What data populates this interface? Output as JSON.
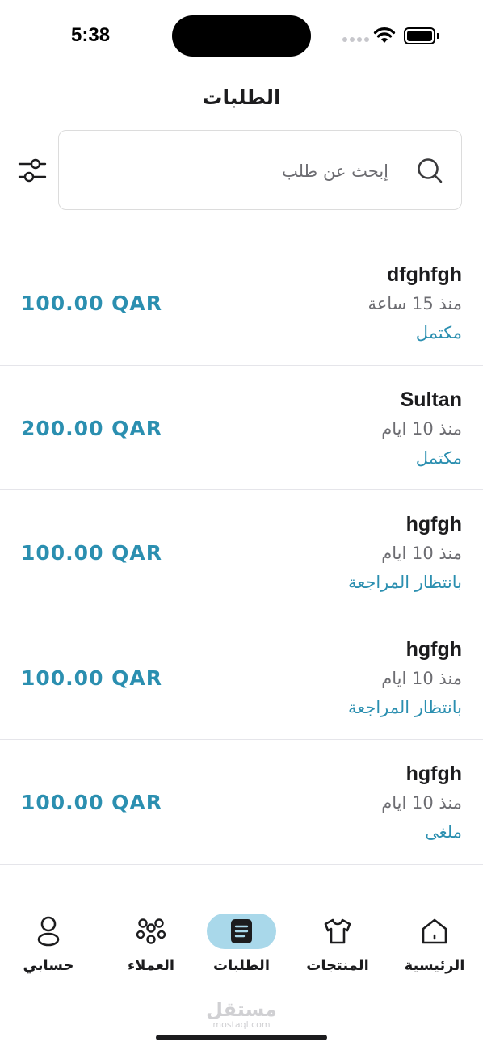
{
  "status_bar": {
    "time": "5:38"
  },
  "header": {
    "title": "الطلبات"
  },
  "search": {
    "placeholder": "إبحث عن طلب"
  },
  "orders": [
    {
      "name": "dfghfgh",
      "time": "منذ 15 ساعة",
      "status": "مكتمل",
      "price": "100.00 QAR"
    },
    {
      "name": "Sultan",
      "time": "منذ 10 ايام",
      "status": "مكتمل",
      "price": "200.00 QAR"
    },
    {
      "name": "hgfgh",
      "time": "منذ 10 ايام",
      "status": "بانتظار المراجعة",
      "price": "100.00 QAR"
    },
    {
      "name": "hgfgh",
      "time": "منذ 10 ايام",
      "status": "بانتظار المراجعة",
      "price": "100.00 QAR"
    },
    {
      "name": "hgfgh",
      "time": "منذ 10 ايام",
      "status": "ملغى",
      "price": "100.00 QAR"
    }
  ],
  "tabs": [
    {
      "label": "الرئيسية",
      "icon": "home-icon"
    },
    {
      "label": "المنتجات",
      "icon": "shirt-icon"
    },
    {
      "label": "الطلبات",
      "icon": "orders-icon",
      "active": true
    },
    {
      "label": "العملاء",
      "icon": "customers-icon"
    },
    {
      "label": "حسابي",
      "icon": "user-icon"
    }
  ],
  "watermark": {
    "arabic": "مستقل",
    "latin": "mostaql.com"
  },
  "colors": {
    "accent": "#2b8fb0",
    "active_tab_bg": "#a9d8ea",
    "muted_text": "#6d6d72"
  }
}
